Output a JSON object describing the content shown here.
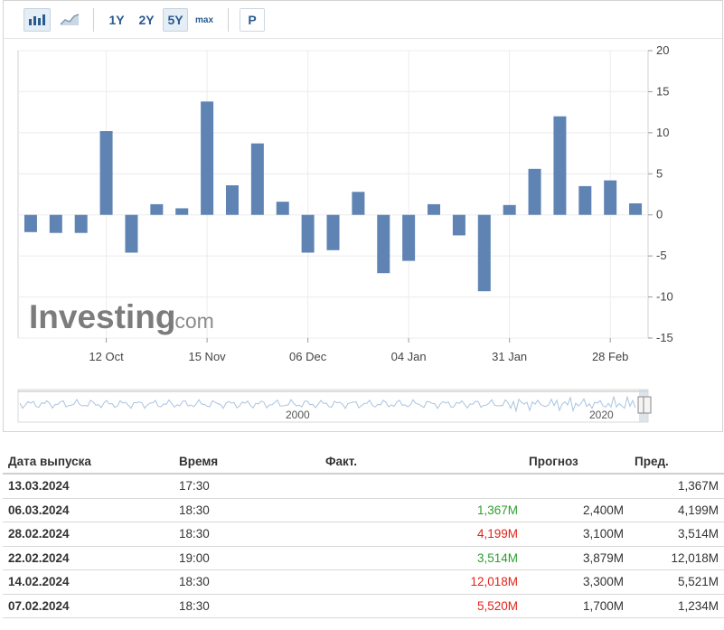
{
  "toolbar": {
    "bar_icon": "bar-chart-icon",
    "area_icon": "area-chart-icon",
    "periods": [
      "1Y",
      "2Y",
      "5Y"
    ],
    "max_label": "max",
    "p_label": "P",
    "active_period": "5Y"
  },
  "watermark": {
    "brand": "Investing",
    "suffix": ".com"
  },
  "chart_data": {
    "type": "bar",
    "title": "",
    "xlabel": "",
    "ylabel": "",
    "ylim": [
      -15,
      20
    ],
    "yticks": [
      20,
      15,
      10,
      5,
      0,
      -5,
      -10,
      -15
    ],
    "xtick_labels": [
      "12 Oct",
      "15 Nov",
      "06 Dec",
      "04 Jan",
      "31 Jan",
      "28 Feb"
    ],
    "values": [
      -2.1,
      -2.2,
      -2.2,
      10.2,
      -4.6,
      1.3,
      0.8,
      13.8,
      3.6,
      8.7,
      1.6,
      -4.6,
      -4.3,
      2.8,
      -7.1,
      -5.6,
      1.3,
      -2.5,
      -9.3,
      1.2,
      5.6,
      12.0,
      3.5,
      4.2,
      1.4
    ],
    "color": "#5f84b4",
    "grid": true,
    "navigator_labels": [
      "2000",
      "2020"
    ]
  },
  "table": {
    "headers": [
      "Дата выпуска",
      "Время",
      "Факт.",
      "Прогноз",
      "Пред."
    ],
    "rows": [
      {
        "date": "13.03.2024",
        "time": "17:30",
        "actual": "",
        "forecast": "",
        "previous": "1,367M",
        "actual_status": ""
      },
      {
        "date": "06.03.2024",
        "time": "18:30",
        "actual": "1,367M",
        "forecast": "2,400M",
        "previous": "4,199M",
        "actual_status": "green"
      },
      {
        "date": "28.02.2024",
        "time": "18:30",
        "actual": "4,199M",
        "forecast": "3,100M",
        "previous": "3,514M",
        "actual_status": "red"
      },
      {
        "date": "22.02.2024",
        "time": "19:00",
        "actual": "3,514M",
        "forecast": "3,879M",
        "previous": "12,018M",
        "actual_status": "green"
      },
      {
        "date": "14.02.2024",
        "time": "18:30",
        "actual": "12,018M",
        "forecast": "3,300M",
        "previous": "5,521M",
        "actual_status": "red"
      },
      {
        "date": "07.02.2024",
        "time": "18:30",
        "actual": "5,520M",
        "forecast": "1,700M",
        "previous": "1,234M",
        "actual_status": "red"
      }
    ]
  }
}
